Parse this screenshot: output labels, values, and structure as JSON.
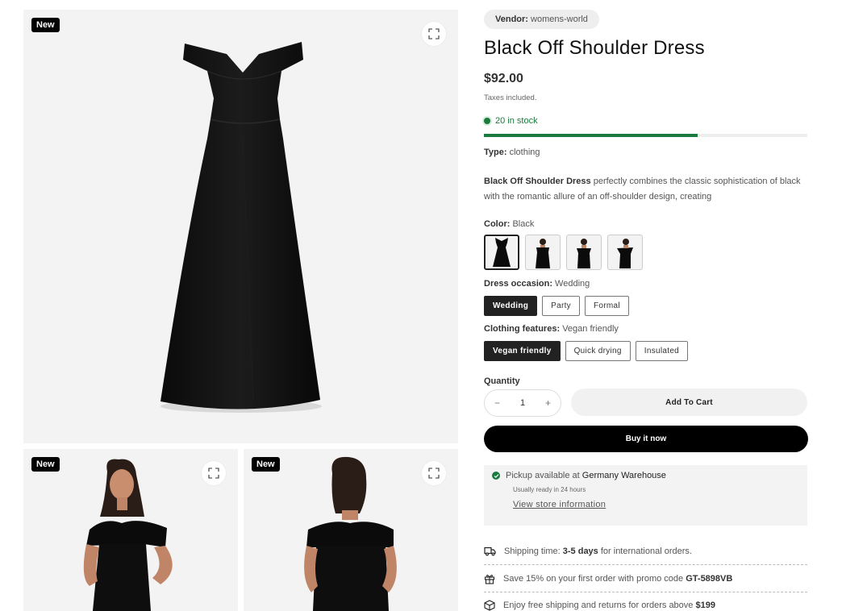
{
  "gallery": {
    "badge_label": "New",
    "images": [
      "dress-flat-lay",
      "model-front",
      "model-back"
    ]
  },
  "product": {
    "vendor_label": "Vendor:",
    "vendor_value": "womens-world",
    "title": "Black Off Shoulder Dress",
    "price": "$92.00",
    "tax_note": "Taxes included.",
    "stock_text": "20 in stock",
    "stock_fraction": 0.66,
    "type_label": "Type:",
    "type_value": "clothing",
    "desc_bold": "Black Off Shoulder Dress",
    "desc_rest": " perfectly combines the classic sophistication of black with the romantic allure of an off-shoulder design, creating"
  },
  "options": {
    "color_label": "Color:",
    "color_value": "Black",
    "color_swatches": [
      "dress-flat",
      "model-front",
      "model-three-quarter",
      "model-side"
    ],
    "occasion_label": "Dress occasion:",
    "occasion_value": "Wedding",
    "occasion_choices": [
      "Wedding",
      "Party",
      "Formal"
    ],
    "features_label": "Clothing features:",
    "features_value": "Vegan friendly",
    "features_choices": [
      "Vegan friendly",
      "Quick drying",
      "Insulated"
    ]
  },
  "purchase": {
    "quantity_label": "Quantity",
    "minus": "−",
    "quantity_value": "1",
    "plus": "+",
    "add_to_cart": "Add To Cart",
    "buy_now": "Buy it now"
  },
  "pickup": {
    "prefix": "Pickup available at ",
    "location": "Germany Warehouse",
    "ready": "Usually ready in 24 hours",
    "link": "View store information"
  },
  "perks": {
    "shipping_pre": "Shipping time: ",
    "shipping_bold": "3-5 days",
    "shipping_post": " for international orders.",
    "promo_pre": "Save 15% on your first order with promo code ",
    "promo_bold": "GT-5898VB",
    "free_pre": "Enjoy free shipping and returns for orders above ",
    "free_bold": "$199"
  }
}
